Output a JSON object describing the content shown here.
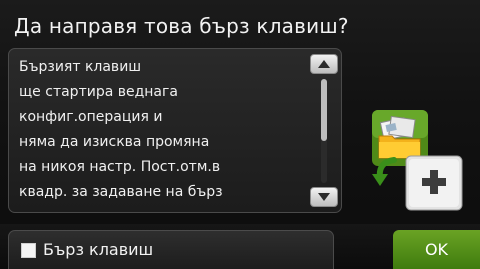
{
  "dialog": {
    "title": "Да направя това бърз клавиш?",
    "message_lines": [
      "Бързият клавиш",
      "ще стартира веднага",
      "конфиг.операция и",
      "няма да изисква промяна",
      "на никоя настр. Пост.отм.в",
      "квадр. за задаване на бърз"
    ]
  },
  "scrollbar": {
    "up_icon": "triangle-up-icon",
    "down_icon": "triangle-down-icon"
  },
  "shortcut_icon": {
    "name": "add-shortcut-icon"
  },
  "footer": {
    "checkbox_label": "Бърз клавиш",
    "checkbox_checked": false,
    "ok_label": "OK"
  },
  "colors": {
    "ok_green": "#5a9a1d",
    "background": "#121212"
  }
}
